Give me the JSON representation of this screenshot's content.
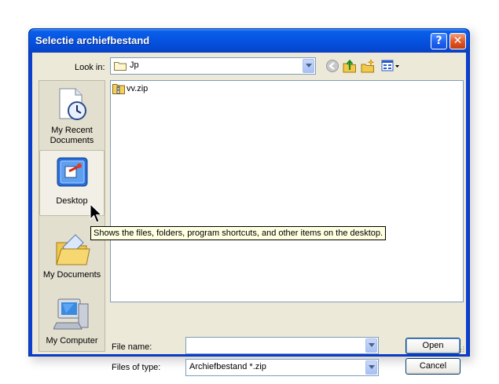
{
  "dialog": {
    "title": "Selectie archiefbestand",
    "help_glyph": "?",
    "close_glyph": "✕"
  },
  "toolbar": {
    "look_in_label": "Look in:",
    "look_in_value": "Jp",
    "icons": [
      "back-icon",
      "up-folder-icon",
      "new-folder-icon",
      "view-menu-icon"
    ]
  },
  "places": [
    {
      "label_line1": "My Recent",
      "label_line2": "Documents",
      "icon": "recent-documents-icon"
    },
    {
      "label_line1": "Desktop",
      "label_line2": "",
      "icon": "desktop-icon"
    },
    {
      "label_line1": "My Documents",
      "label_line2": "",
      "icon": "my-documents-icon"
    },
    {
      "label_line1": "My Computer",
      "label_line2": "",
      "icon": "my-computer-icon"
    }
  ],
  "files": [
    {
      "name": "vv.zip",
      "icon": "zip-folder-icon"
    }
  ],
  "form": {
    "file_name_label": "File name:",
    "file_name_value": "",
    "files_of_type_label": "Files of type:",
    "files_of_type_value": "Archiefbestand *.zip"
  },
  "buttons": {
    "open": "Open",
    "cancel": "Cancel"
  },
  "tooltip": "Shows the files, folders, program shortcuts, and other items on the desktop.",
  "colors": {
    "titlebar": "#0553e0",
    "dialog_bg": "#ece9d8",
    "tooltip_bg": "#ffffe1"
  }
}
